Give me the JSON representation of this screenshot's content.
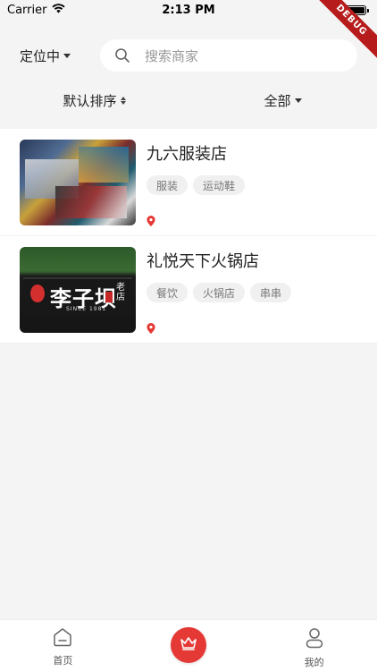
{
  "status_bar": {
    "carrier": "Carrier",
    "time": "2:13 PM"
  },
  "debug_banner": "DEBUG",
  "header": {
    "location_label": "定位中",
    "search_placeholder": "搜索商家"
  },
  "sort": {
    "default_label": "默认排序",
    "all_label": "全部"
  },
  "shops": [
    {
      "name": "九六服装店",
      "tags": [
        "服装",
        "运动鞋"
      ]
    },
    {
      "name": "礼悦天下火锅店",
      "tags": [
        "餐饮",
        "火锅店",
        "串串"
      ]
    }
  ],
  "tabbar": {
    "home_label": "首页",
    "mine_label": "我的"
  },
  "colors": {
    "accent": "#e53935",
    "background": "#f4f4f4"
  },
  "icons": [
    "wifi-icon",
    "battery-icon",
    "search-icon",
    "location-pin-icon",
    "home-icon",
    "crown-icon",
    "user-icon"
  ]
}
